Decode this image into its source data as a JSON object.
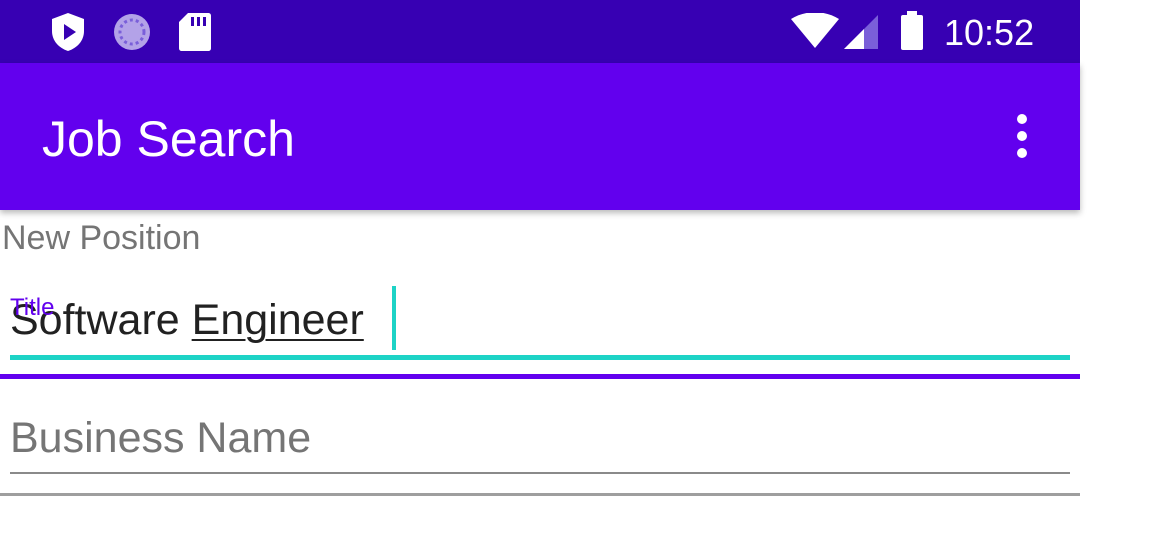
{
  "status_bar": {
    "time": "10:52",
    "icons": [
      "shield-play-icon",
      "sync-icon",
      "sd-card-icon",
      "wifi-icon",
      "cell-signal-icon",
      "battery-icon"
    ]
  },
  "app_bar": {
    "title": "Job Search",
    "overflow_icon": "more-vert-icon"
  },
  "form": {
    "section_label": "New Position",
    "title_field": {
      "label": "Title",
      "value_word1": "Software ",
      "value_word2": "Engineer"
    },
    "business_field": {
      "placeholder": "Business Name"
    }
  },
  "colors": {
    "status_bar": "#3700b3",
    "primary": "#6200ee",
    "accent": "#1dd3c6",
    "hint": "#757575"
  }
}
